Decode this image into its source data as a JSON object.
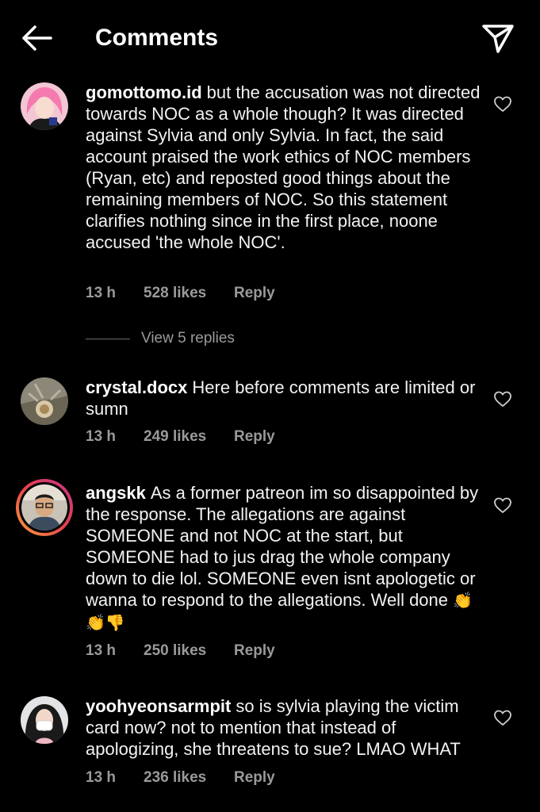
{
  "header": {
    "title": "Comments",
    "back_icon": "arrow-left-icon",
    "send_icon": "paper-plane-icon"
  },
  "comments": [
    {
      "username": "gomottomo.id",
      "text": "but the accusation was not directed towards NOC as a whole though? It was directed against Sylvia and only Sylvia. In fact, the said account praised the work ethics of NOC members (Ryan, etc) and reposted good things about the remaining members of NOC. So this statement clarifies nothing since in the first place, noone accused 'the whole NOC'.",
      "time": "13 h",
      "likes": "528 likes",
      "reply": "Reply",
      "view_replies": "View 5 replies"
    },
    {
      "username": "crystal.docx",
      "text": "Here before comments are limited or sumn",
      "time": "13 h",
      "likes": "249 likes",
      "reply": "Reply"
    },
    {
      "username": "angskk",
      "text": "As a former patreon im so disappointed by the response. The allegations are against SOMEONE and not NOC at the start, but SOMEONE had to jus drag the whole company down to die lol. SOMEONE even isnt apologetic or wanna to respond to the allegations. Well done",
      "emoji": "👏👏👎",
      "time": "13 h",
      "likes": "250 likes",
      "reply": "Reply"
    },
    {
      "username": "yoohyeonsarmpit",
      "text": "so is sylvia playing the victim card now? not to mention that instead of apologizing, she threatens to sue? LMAO WHAT",
      "time": "13 h",
      "likes": "236 likes",
      "reply": "Reply"
    }
  ],
  "colors": {
    "background": "#000000",
    "text": "#f2f2f2",
    "meta": "#9a9a9a",
    "story_ring": [
      "#f9a13b",
      "#e8414d",
      "#c13584"
    ]
  }
}
